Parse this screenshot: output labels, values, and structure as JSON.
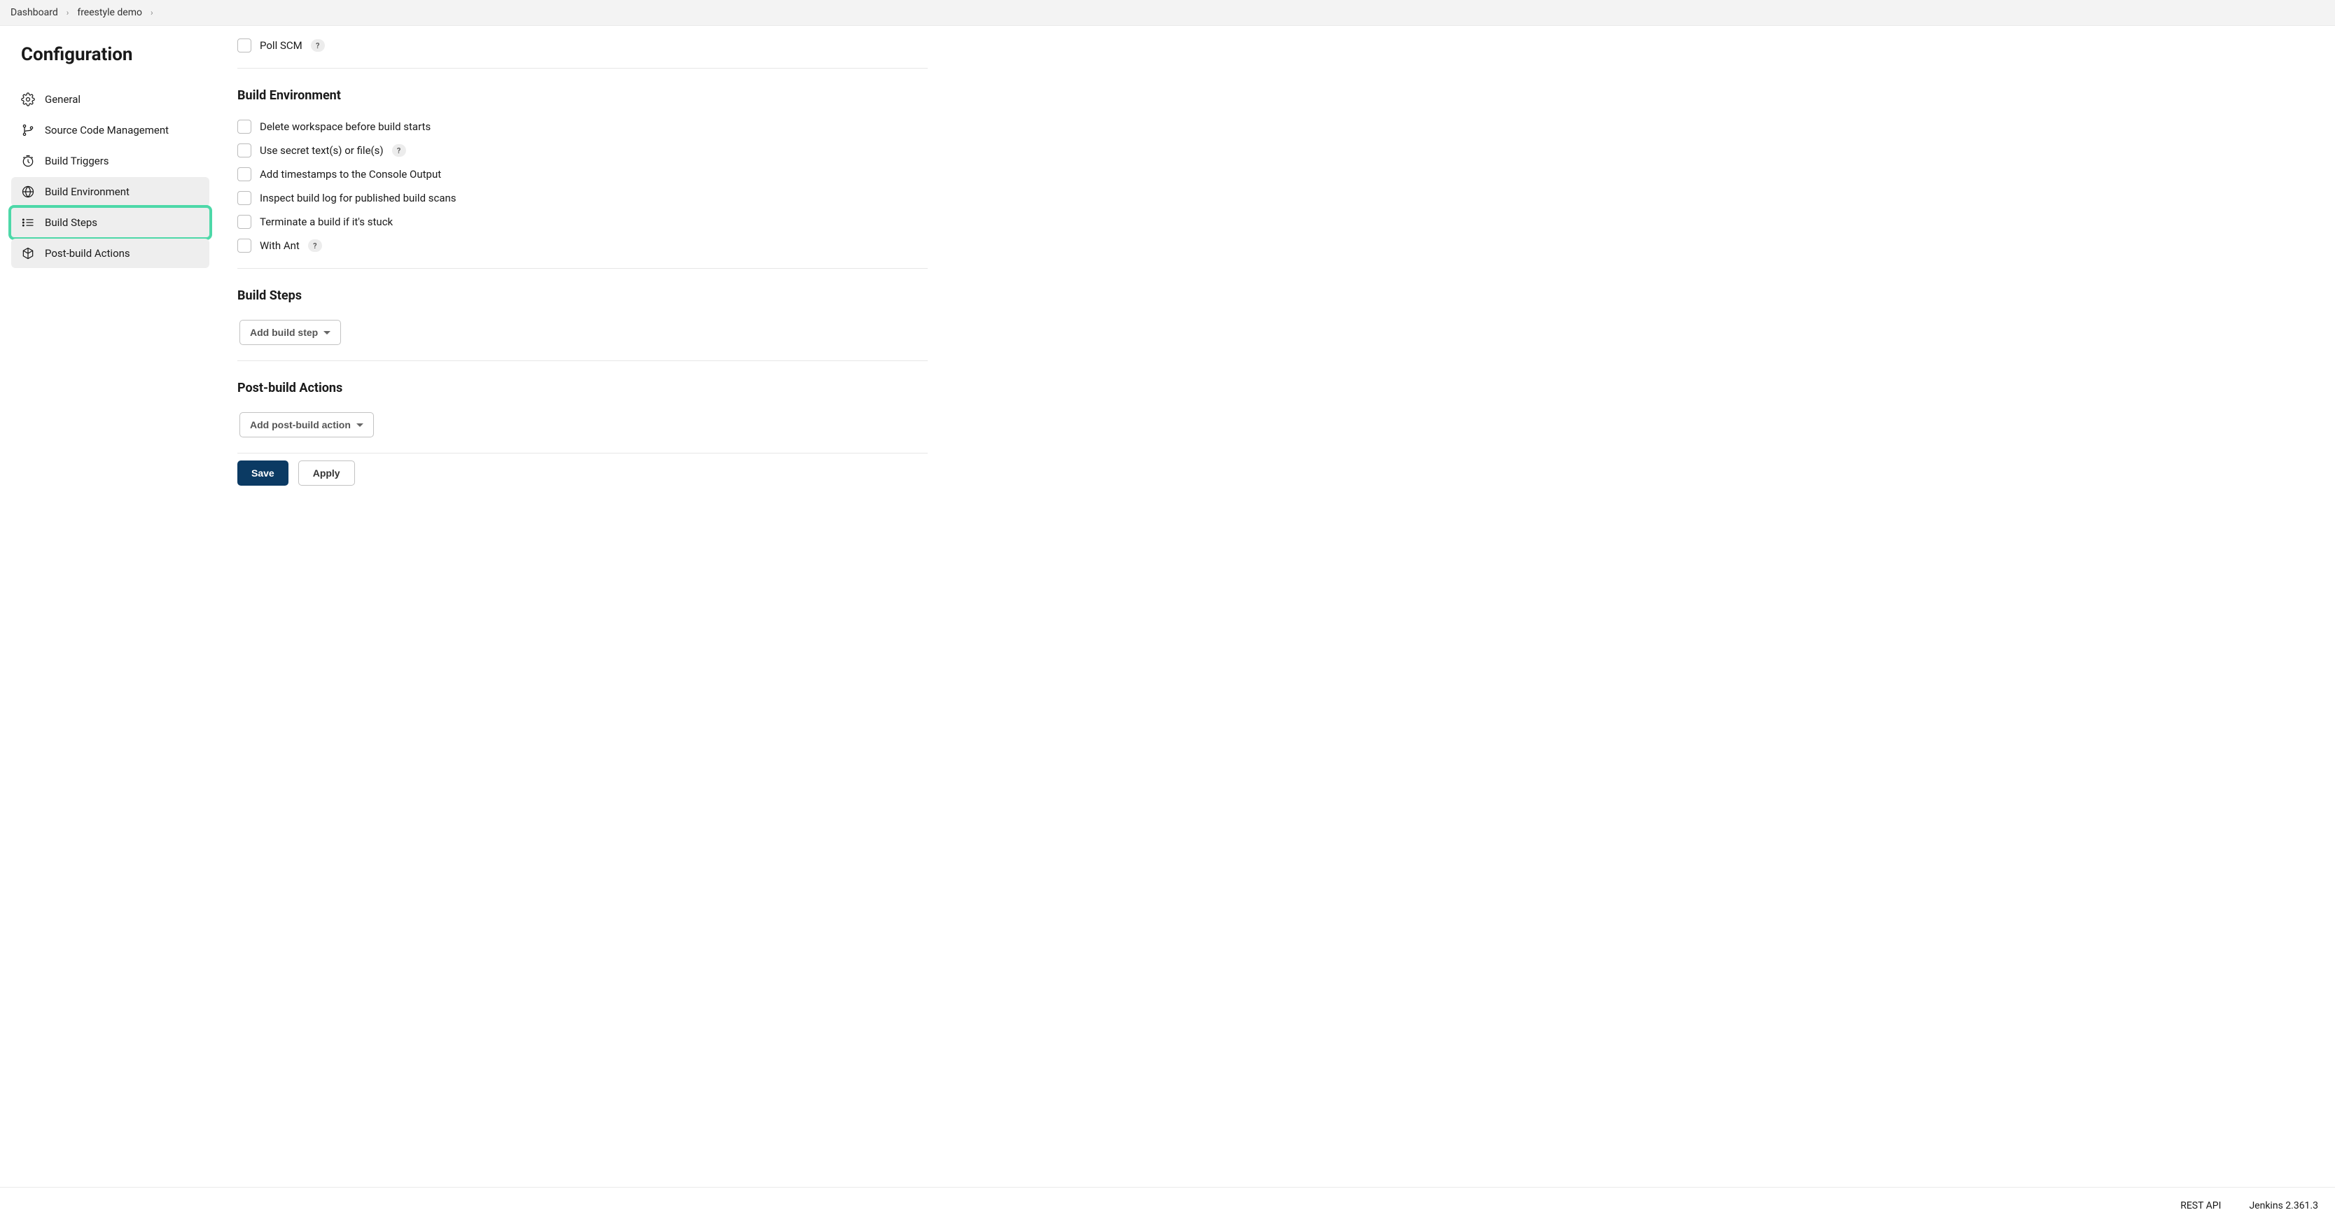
{
  "breadcrumb": {
    "items": [
      "Dashboard",
      "freestyle demo"
    ]
  },
  "page": {
    "title": "Configuration"
  },
  "sidebar": {
    "items": [
      {
        "label": "General"
      },
      {
        "label": "Source Code Management"
      },
      {
        "label": "Build Triggers"
      },
      {
        "label": "Build Environment"
      },
      {
        "label": "Build Steps"
      },
      {
        "label": "Post-build Actions"
      }
    ]
  },
  "topCheckbox": {
    "label": "Poll SCM"
  },
  "buildEnvironment": {
    "heading": "Build Environment",
    "options": [
      {
        "label": "Delete workspace before build starts",
        "help": false
      },
      {
        "label": "Use secret text(s) or file(s)",
        "help": true
      },
      {
        "label": "Add timestamps to the Console Output",
        "help": false
      },
      {
        "label": "Inspect build log for published build scans",
        "help": false
      },
      {
        "label": "Terminate a build if it's stuck",
        "help": false
      },
      {
        "label": "With Ant",
        "help": true
      }
    ]
  },
  "buildSteps": {
    "heading": "Build Steps",
    "addButton": "Add build step"
  },
  "postBuild": {
    "heading": "Post-build Actions",
    "addButton": "Add post-build action"
  },
  "actions": {
    "save": "Save",
    "apply": "Apply"
  },
  "footer": {
    "restApi": "REST API",
    "version": "Jenkins 2.361.3"
  },
  "helpChar": "?"
}
